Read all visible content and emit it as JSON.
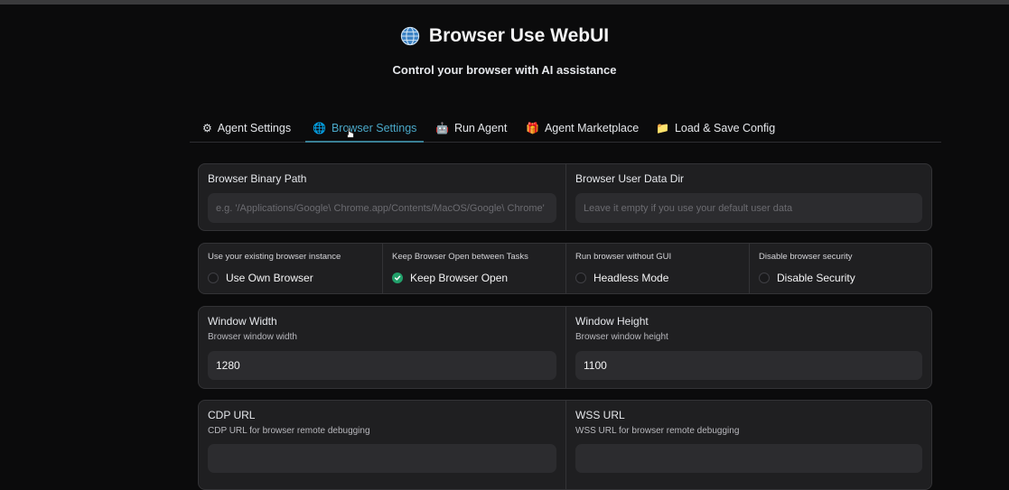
{
  "app": {
    "title": "Browser Use WebUI",
    "subtitle": "Control your browser with AI assistance",
    "title_icon": "globe-icon"
  },
  "tabs": [
    {
      "label": "Agent Settings",
      "icon": "gear-icon",
      "glyph": "⚙"
    },
    {
      "label": "Browser Settings",
      "icon": "globe-icon",
      "glyph": "🌐",
      "active": true
    },
    {
      "label": "Run Agent",
      "icon": "robot-icon",
      "glyph": "🤖"
    },
    {
      "label": "Agent Marketplace",
      "icon": "gift-icon",
      "glyph": "🎁"
    },
    {
      "label": "Load & Save Config",
      "icon": "folder-icon",
      "glyph": "📁"
    }
  ],
  "paths": {
    "binary_label": "Browser Binary Path",
    "binary_placeholder": "e.g. '/Applications/Google\\ Chrome.app/Contents/MacOS/Google\\ Chrome'",
    "user_data_label": "Browser User Data Dir",
    "user_data_placeholder": "Leave it empty if you use your default user data"
  },
  "options": [
    {
      "label": "Use your existing browser instance",
      "value_label": "Use Own Browser",
      "checked": false
    },
    {
      "label": "Keep Browser Open between Tasks",
      "value_label": "Keep Browser Open",
      "checked": true
    },
    {
      "label": "Run browser without GUI",
      "value_label": "Headless Mode",
      "checked": false
    },
    {
      "label": "Disable browser security",
      "value_label": "Disable Security",
      "checked": false
    }
  ],
  "window": {
    "width_label": "Window Width",
    "width_info": "Browser window width",
    "width_value": "1280",
    "height_label": "Window Height",
    "height_info": "Browser window height",
    "height_value": "1100"
  },
  "urls": {
    "cdp_label": "CDP URL",
    "cdp_info": "CDP URL for browser remote debugging",
    "cdp_value": "",
    "wss_label": "WSS URL",
    "wss_info": "WSS URL for browser remote debugging",
    "wss_value": ""
  },
  "colors": {
    "background": "#0b0b0c",
    "panel": "#1f1f21",
    "input": "#2c2c2f",
    "accent": "#4aa8c8",
    "check": "#22a06b"
  }
}
